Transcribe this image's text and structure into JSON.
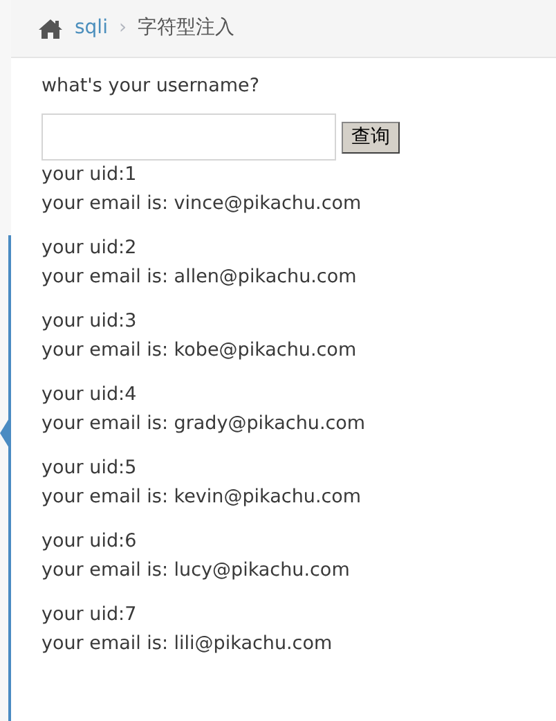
{
  "breadcrumb": {
    "link": "sqli",
    "separator": "›",
    "current": "字符型注入"
  },
  "form": {
    "label": "what's your username?",
    "button": "查询"
  },
  "results": [
    {
      "uid": "your uid:1",
      "email": "your email is: vince@pikachu.com"
    },
    {
      "uid": "your uid:2",
      "email": "your email is: allen@pikachu.com"
    },
    {
      "uid": "your uid:3",
      "email": "your email is: kobe@pikachu.com"
    },
    {
      "uid": "your uid:4",
      "email": "your email is: grady@pikachu.com"
    },
    {
      "uid": "your uid:5",
      "email": "your email is: kevin@pikachu.com"
    },
    {
      "uid": "your uid:6",
      "email": "your email is: lucy@pikachu.com"
    },
    {
      "uid": "your uid:7",
      "email": "your email is: lili@pikachu.com"
    }
  ]
}
